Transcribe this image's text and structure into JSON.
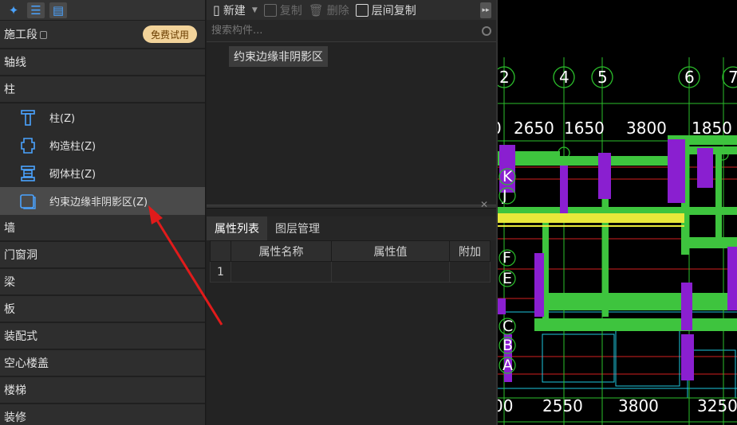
{
  "left_panel": {
    "sections_top": [
      {
        "name": "section-construction-phase",
        "label": "施工段",
        "badge": "免费试用"
      },
      {
        "name": "section-axis",
        "label": "轴线"
      },
      {
        "name": "section-column",
        "label": "柱"
      }
    ],
    "column_items": [
      {
        "name": "item-column",
        "label": "柱(Z)",
        "icon": "column-icon"
      },
      {
        "name": "item-structural-column",
        "label": "构造柱(Z)",
        "icon": "structural-column-icon"
      },
      {
        "name": "item-masonry-column",
        "label": "砌体柱(Z)",
        "icon": "masonry-column-icon"
      },
      {
        "name": "item-boundary-zone",
        "label": "约束边缘非阴影区(Z)",
        "icon": "boundary-zone-icon"
      }
    ],
    "sections_bottom": [
      {
        "name": "section-wall",
        "label": "墙"
      },
      {
        "name": "section-door-window",
        "label": "门窗洞"
      },
      {
        "name": "section-beam",
        "label": "梁"
      },
      {
        "name": "section-slab",
        "label": "板"
      },
      {
        "name": "section-prefab",
        "label": "装配式"
      },
      {
        "name": "section-hollow-floor",
        "label": "空心楼盖"
      },
      {
        "name": "section-stairs",
        "label": "楼梯"
      },
      {
        "name": "section-decoration",
        "label": "装修"
      }
    ]
  },
  "toolbar": {
    "new": "新建",
    "copy": "复制",
    "delete": "删除",
    "floor_copy": "层间复制"
  },
  "search": {
    "placeholder": "搜索构件..."
  },
  "components": [
    "约束边缘非阴影区"
  ],
  "properties": {
    "tabs": [
      "属性列表",
      "图层管理"
    ],
    "headers": [
      "属性名称",
      "属性值",
      "附加"
    ],
    "rows": [
      {
        "index": "1",
        "name": "",
        "value": "",
        "extra": ""
      }
    ]
  },
  "drawing": {
    "axis_numbers_top": [
      "2",
      "4",
      "5",
      "6",
      "7"
    ],
    "dims_top": [
      "0",
      "2650",
      "1650",
      "3800",
      "1850"
    ],
    "axis_letters": [
      "K",
      "J",
      "F",
      "E",
      "C",
      "B",
      "A"
    ],
    "dims_bottom": [
      "00",
      "2550",
      "3800",
      "3250"
    ],
    "colors": {
      "beam_green": "#3ec43e",
      "column_purple": "#8a1fd0",
      "wall_yellow": "#e8e83a",
      "line_red": "#d42020",
      "line_cyan": "#1ec8e0"
    }
  }
}
